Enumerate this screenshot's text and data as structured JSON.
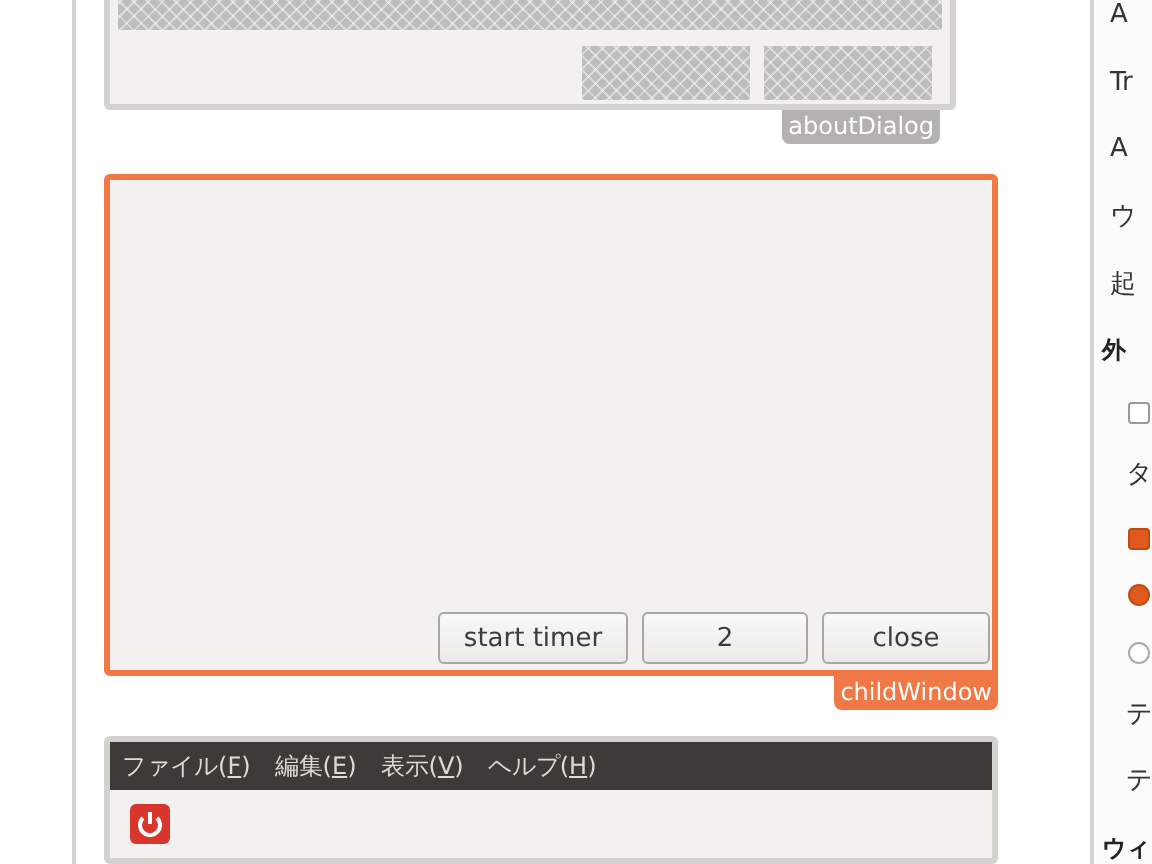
{
  "about_dialog": {
    "tag": "aboutDialog"
  },
  "child_window": {
    "tag": "childWindow",
    "buttons": [
      "start timer",
      "2",
      "close"
    ]
  },
  "main_window": {
    "menu": [
      {
        "before": "ファイル(",
        "key": "F",
        "after": ")"
      },
      {
        "before": "編集(",
        "key": "E",
        "after": ")"
      },
      {
        "before": "表示(",
        "key": "V",
        "after": ")"
      },
      {
        "before": "ヘルプ(",
        "key": "H",
        "after": ")"
      }
    ]
  },
  "settings_panel": [
    {
      "kind": "text",
      "label": "A"
    },
    {
      "kind": "text",
      "label": "Tr"
    },
    {
      "kind": "text",
      "label": "A"
    },
    {
      "kind": "text",
      "label": "ウ"
    },
    {
      "kind": "text",
      "label": "起"
    },
    {
      "kind": "heading",
      "label": "外"
    },
    {
      "kind": "checkbox",
      "checked": false
    },
    {
      "kind": "subtext",
      "label": "タ"
    },
    {
      "kind": "checkbox",
      "checked": true
    },
    {
      "kind": "radio",
      "selected": true
    },
    {
      "kind": "radio",
      "selected": false
    },
    {
      "kind": "subtext",
      "label": "テ"
    },
    {
      "kind": "subtext",
      "label": "テ"
    },
    {
      "kind": "heading",
      "label": "ウィ"
    }
  ]
}
